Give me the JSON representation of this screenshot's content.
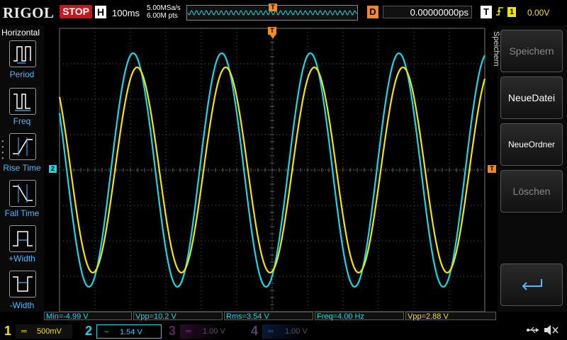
{
  "header": {
    "brand": "RIGOL",
    "run_state": "STOP",
    "timebase_label": "H",
    "timebase_value": "100ms",
    "sample_rate": "5.00MSa/s",
    "memory_depth": "6.00M pts",
    "trigger_position_marker": "T",
    "delay_label": "D",
    "delay_value": "0.00000000ps",
    "trigger_label": "T",
    "trigger_edge_icon": "rising-edge-icon",
    "trigger_source": "1",
    "trigger_level": "0.00V"
  },
  "left_panel": {
    "title": "Horizontal",
    "items": [
      {
        "label": "Period",
        "icon": "period-icon"
      },
      {
        "label": "Freq",
        "icon": "frequency-icon"
      },
      {
        "label": "Rise Time",
        "icon": "rise-time-icon"
      },
      {
        "label": "Fall Time",
        "icon": "fall-time-icon"
      },
      {
        "label": "+Width",
        "icon": "positive-width-icon"
      },
      {
        "label": "-Width",
        "icon": "negative-width-icon"
      }
    ]
  },
  "right_menu": {
    "title": "Speichern",
    "buttons": [
      {
        "label": "Speichern",
        "enabled": false
      },
      {
        "label": "NeueDatei",
        "enabled": true
      },
      {
        "label": "NeueOrdner",
        "enabled": true
      },
      {
        "label": "Löschen",
        "enabled": false
      }
    ],
    "back_icon": "return-arrow-icon"
  },
  "plot": {
    "ch2_marker": "2",
    "trigger_level_marker": "T",
    "trigger_top_marker": "T",
    "colors": {
      "ch1": "#f5e400",
      "ch2": "#18d8e6",
      "grid": "#5a5a5a",
      "trigger": "#f08a24"
    },
    "traces": {
      "ch1_cycles_visible": 4.8,
      "ch1_amplitude_div": 2.9,
      "ch2_amplitude_div": 3.3,
      "ch2_lead_fraction_of_period": 0.045
    }
  },
  "measurements": [
    {
      "text": "Min=-4.99 V",
      "color": "#18d8e6"
    },
    {
      "text": "Vpp=10.2 V",
      "color": "#18d8e6"
    },
    {
      "text": "Rms=3.54 V",
      "color": "#18d8e6"
    },
    {
      "text": "Freq=4.00 Hz",
      "color": "#18d8e6"
    },
    {
      "text": "Vpp=2.88 V",
      "color": "#f5e400"
    }
  ],
  "channels": [
    {
      "num": "1",
      "coupling": "═",
      "scale": "500mV",
      "color": "#f5e400",
      "active": true
    },
    {
      "num": "2",
      "coupling": "~",
      "scale": "1.54 V",
      "color": "#18d8e6",
      "active": true
    },
    {
      "num": "3",
      "coupling": "═",
      "scale": "1.00 V",
      "color": "#b01cb0",
      "active": false
    },
    {
      "num": "4",
      "coupling": "═",
      "scale": "1.00 V",
      "color": "#2a6ee0",
      "active": false
    }
  ],
  "status_icons": {
    "usb": "usb-icon",
    "speaker": "speaker-muted-icon"
  }
}
